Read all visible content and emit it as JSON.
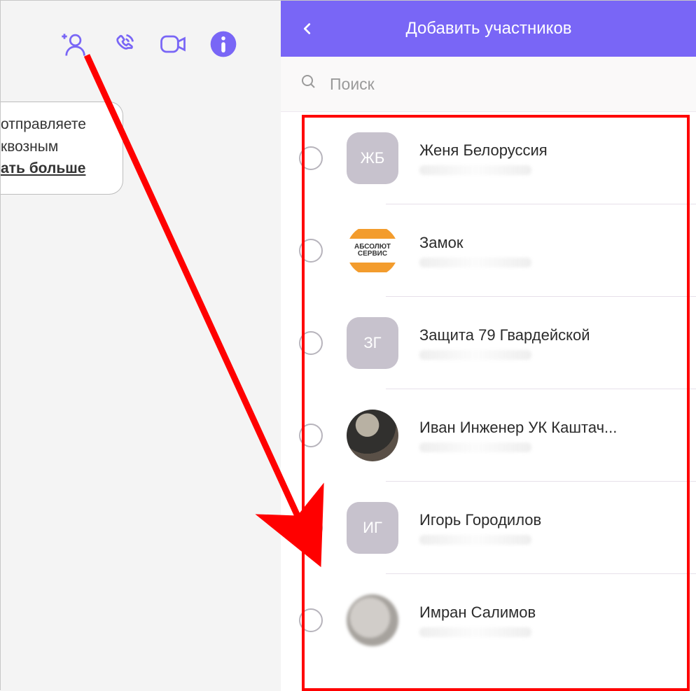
{
  "colors": {
    "brand": "#7966f6",
    "highlight": "#ff0000",
    "icon": "#7966f6"
  },
  "left": {
    "info_line1": "отправляете",
    "info_line2": "квозным",
    "info_link": "ать больше"
  },
  "header": {
    "title": "Добавить участников"
  },
  "search": {
    "placeholder": "Поиск"
  },
  "contacts": [
    {
      "name": "Женя Белоруссия",
      "initials": "ЖБ",
      "avatar_type": "initials"
    },
    {
      "name": "Замок",
      "initials": "",
      "avatar_type": "logo",
      "logo_top": "АБСОЛЮТ",
      "logo_bot": "СЕРВИС"
    },
    {
      "name": "Защита 79 Гвардейской",
      "initials": "ЗГ",
      "avatar_type": "initials"
    },
    {
      "name": "Иван Инженер УК Каштач...",
      "initials": "",
      "avatar_type": "photo1"
    },
    {
      "name": "Игорь Городилов",
      "initials": "ИГ",
      "avatar_type": "initials"
    },
    {
      "name": "Имран Салимов",
      "initials": "",
      "avatar_type": "photo2"
    }
  ]
}
